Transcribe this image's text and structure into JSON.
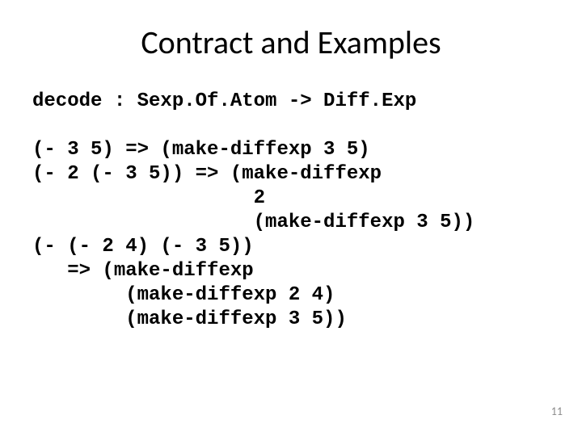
{
  "title": "Contract and Examples",
  "code": {
    "l01": "decode : Sexp.Of.Atom -> Diff.Exp",
    "l02": "",
    "l03": "(- 3 5) => (make-diffexp 3 5)",
    "l04": "(- 2 (- 3 5)) => (make-diffexp",
    "l05": "                   2",
    "l06": "                   (make-diffexp 3 5))",
    "l07": "(- (- 2 4) (- 3 5))",
    "l08": "   => (make-diffexp",
    "l09": "        (make-diffexp 2 4)",
    "l10": "        (make-diffexp 3 5))"
  },
  "pagenum": "11"
}
